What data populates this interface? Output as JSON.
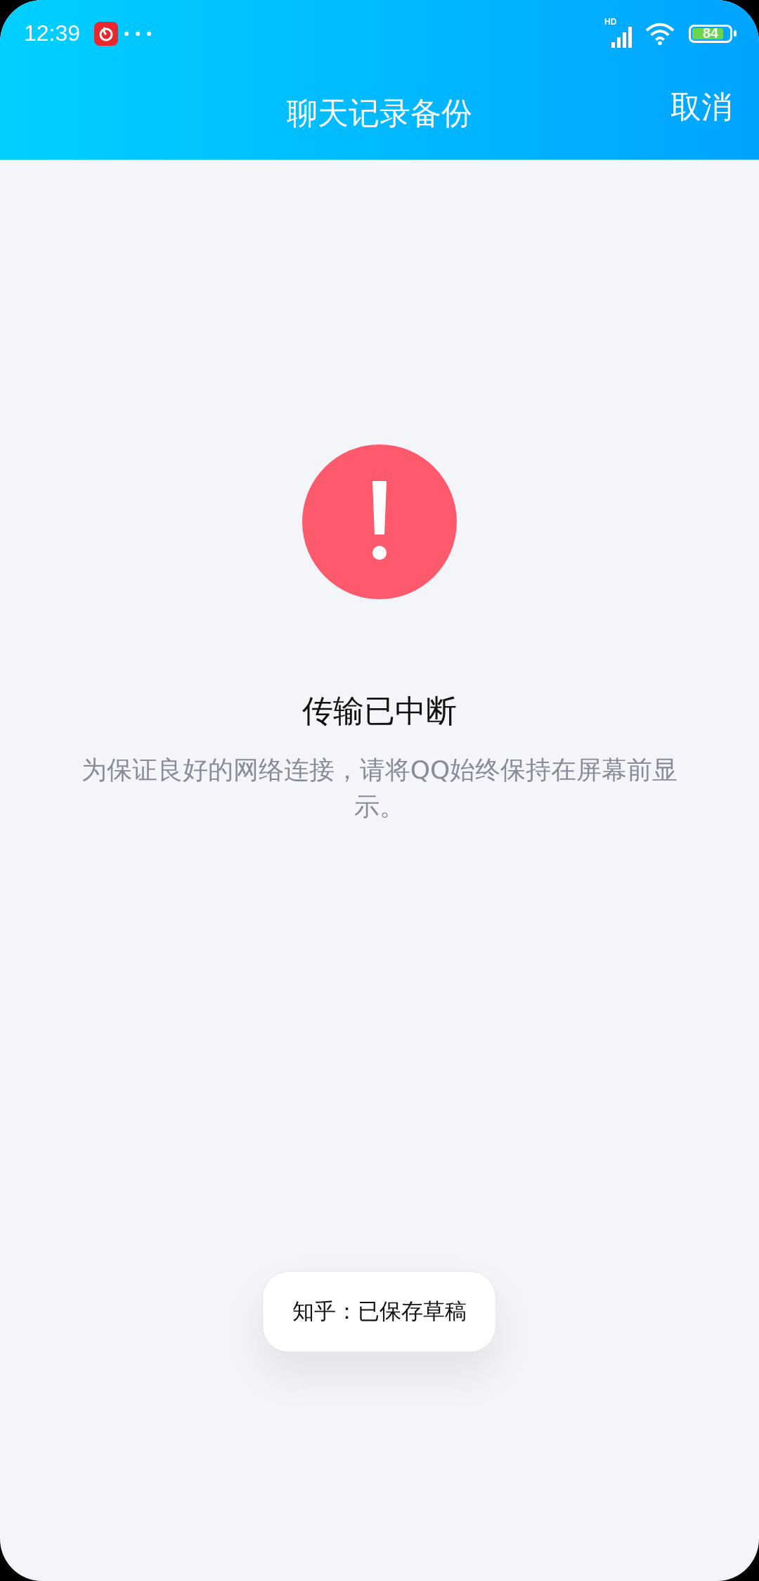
{
  "status_bar": {
    "time": "12:39",
    "network_label": "HD",
    "battery": {
      "text": "84"
    }
  },
  "header": {
    "title": "聊天记录备份",
    "action": "取消"
  },
  "message": {
    "title": "传输已中断",
    "description": "为保证良好的网络连接，请将QQ始终保持在屏幕前显示。"
  },
  "toast": {
    "text": "知乎：已保存草稿"
  }
}
